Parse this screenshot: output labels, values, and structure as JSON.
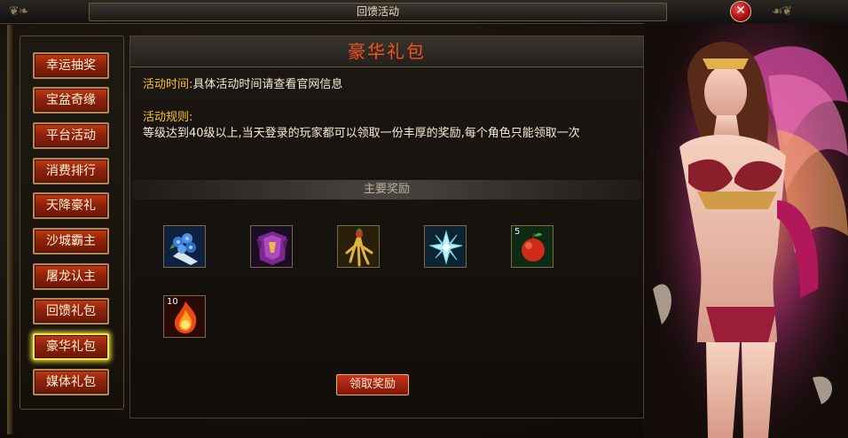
{
  "window": {
    "title": "回馈活动",
    "close_icon": "close-icon"
  },
  "sidebar": {
    "items": [
      {
        "label": "幸运抽奖",
        "active": false
      },
      {
        "label": "宝盆奇缘",
        "active": false
      },
      {
        "label": "平台活动",
        "active": false
      },
      {
        "label": "消费排行",
        "active": false
      },
      {
        "label": "天降豪礼",
        "active": false
      },
      {
        "label": "沙城霸主",
        "active": false
      },
      {
        "label": "屠龙认主",
        "active": false
      },
      {
        "label": "回馈礼包",
        "active": false
      },
      {
        "label": "豪华礼包",
        "active": true
      },
      {
        "label": "媒体礼包",
        "active": false
      }
    ]
  },
  "main": {
    "title": "豪华礼包",
    "time_label": "活动时间:",
    "time_value": "具体活动时间请查看官网信息",
    "rules_label": "活动规则:",
    "rules_text": "等级达到40级以上,当天登录的玩家都可以领取一份丰厚的奖励,每个角色只能领取一次",
    "rewards_header": "主要奖励",
    "rewards": [
      {
        "icon": "flower-bouquet-icon",
        "qty": ""
      },
      {
        "icon": "purple-armor-icon",
        "qty": ""
      },
      {
        "icon": "golden-ginseng-icon",
        "qty": ""
      },
      {
        "icon": "crystal-flower-icon",
        "qty": ""
      },
      {
        "icon": "red-apple-icon",
        "qty": "5"
      },
      {
        "icon": "fire-orb-icon",
        "qty": "10"
      }
    ],
    "claim_label": "领取奖励"
  },
  "colors": {
    "accent": "#f2541c",
    "label": "#f7c12a",
    "button": "#b02a0e",
    "highlight": "#f6e64a"
  }
}
